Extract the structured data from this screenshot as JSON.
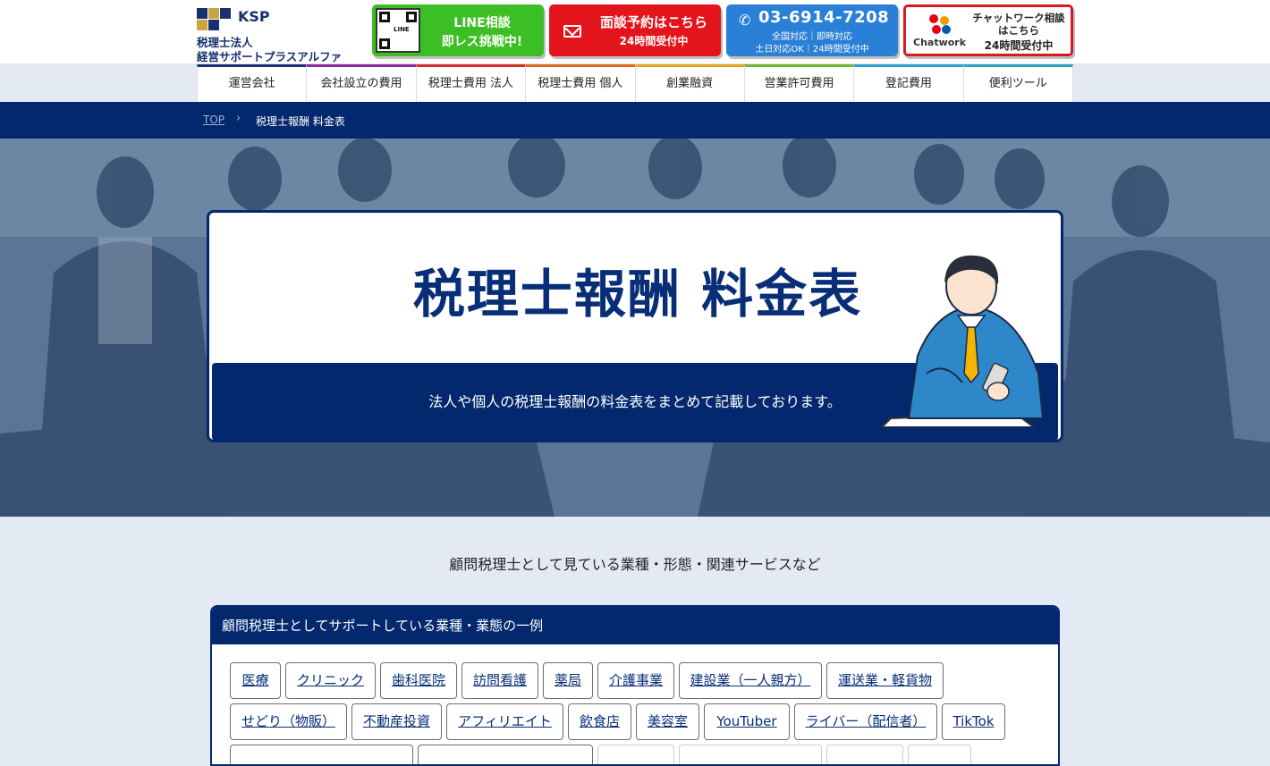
{
  "header": {
    "logo_brand": "KSP",
    "logo_line1": "税理士法人",
    "logo_line2": "経営サポートプラスアルファ",
    "line_cta": {
      "qr_label": "LINE",
      "line1": "LINE相談",
      "line2": "即レス挑戦中!"
    },
    "mail_cta": {
      "line1": "面談予約はこちら",
      "line2": "24時間受付中"
    },
    "tel_cta": {
      "number": "03-6914-7208",
      "line1": "全国対応｜即時対応",
      "line2": "土日対応OK｜24時間受付中"
    },
    "chat_cta": {
      "brand": "Chatwork",
      "line1": "チャットワーク相談",
      "line2": "はこちら",
      "line3": "24時間受付中"
    }
  },
  "nav": {
    "items": [
      {
        "label": "運営会社",
        "color": "#17306e"
      },
      {
        "label": "会社設立の費用",
        "color": "#8a2aa0"
      },
      {
        "label": "税理士費用 法人",
        "color": "#d92a2a"
      },
      {
        "label": "税理士費用 個人",
        "color": "#e2661f"
      },
      {
        "label": "創業融資",
        "color": "#e7a41a"
      },
      {
        "label": "営業許可費用",
        "color": "#6cb830"
      },
      {
        "label": "登記費用",
        "color": "#2f9fd3"
      },
      {
        "label": "便利ツール",
        "color": "#25a7b8"
      }
    ]
  },
  "breadcrumb": {
    "top": "TOP",
    "sep": "›",
    "current": "税理士報酬 料金表"
  },
  "hero": {
    "title": "税理士報酬 料金表",
    "subtitle": "法人や個人の税理士報酬の料金表をまとめて記載しております。"
  },
  "intro": "顧問税理士として見ている業種・形態・関連サービスなど",
  "panel": {
    "title": "顧問税理士としてサポートしている業種・業態の一例",
    "tags": [
      "医療",
      "クリニック",
      "歯科医院",
      "訪問看護",
      "薬局",
      "介護事業",
      "建設業（一人親方）",
      "運送業・軽貨物",
      "せどり（物販）",
      "不動産投資",
      "アフィリエイト",
      "飲食店",
      "美容室",
      "YouTuber",
      "ライバー（配信者）",
      "TikTok"
    ]
  },
  "colors": {
    "navy": "#03286d",
    "line_green": "#3cbf24",
    "mail_red": "#e3141c",
    "tel_blue": "#2a7fd6"
  }
}
